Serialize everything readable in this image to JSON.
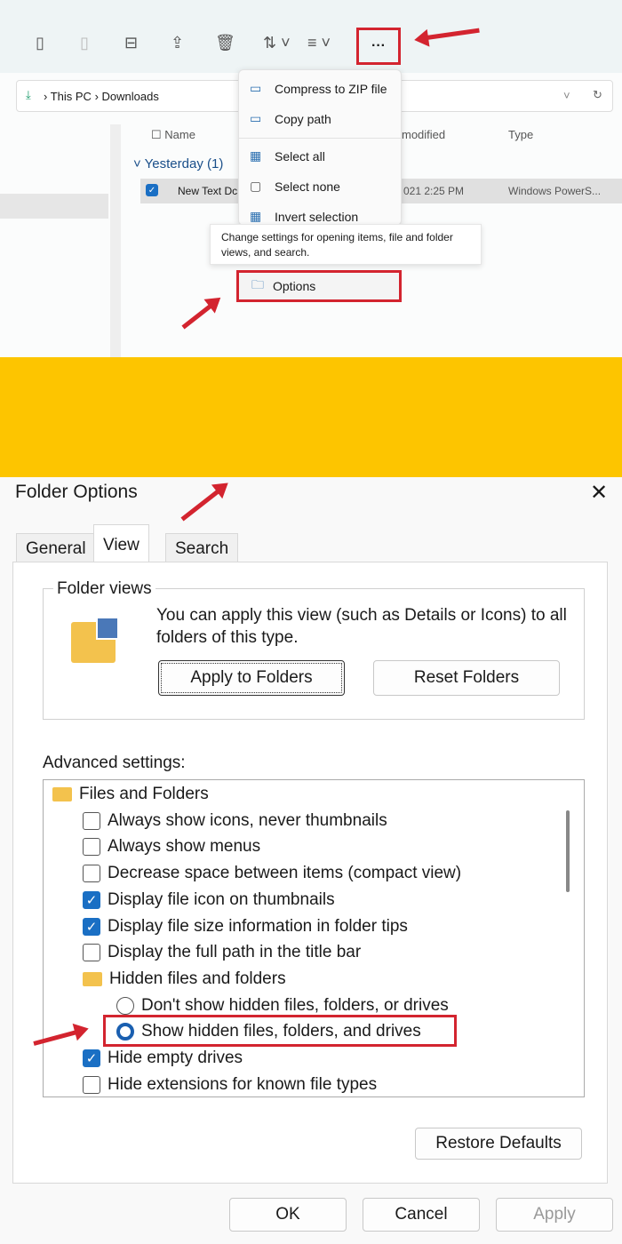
{
  "explorer": {
    "toolbar_icons": [
      "cut-icon",
      "copy-icon",
      "paste-icon",
      "rename-icon",
      "share-icon",
      "delete-icon",
      "sort-icon",
      "view-icon"
    ],
    "more_label": "···",
    "breadcrumb": [
      "This PC",
      "Downloads"
    ],
    "columns": [
      "Name",
      "modified",
      "Type"
    ],
    "group": "Yesterday (1)",
    "file": {
      "name": "New Text Dc",
      "date": "021 2:25 PM",
      "type": "Windows PowerS..."
    },
    "menu": [
      "Compress to ZIP file",
      "Copy path",
      "Select all",
      "Select none",
      "Invert selection"
    ],
    "tooltip": "Change settings for opening items, file and folder views, and search.",
    "options_label": "Options"
  },
  "dialog": {
    "title": "Folder Options",
    "close": "✕",
    "tabs": [
      "General",
      "View",
      "Search"
    ],
    "folder_views": {
      "legend": "Folder views",
      "text": "You can apply this view (such as Details or Icons) to all folders of this type.",
      "apply": "Apply to Folders",
      "reset": "Reset Folders"
    },
    "advanced_label": "Advanced settings:",
    "items": [
      {
        "type": "folder",
        "label": "Files and Folders"
      },
      {
        "type": "check",
        "checked": false,
        "label": "Always show icons, never thumbnails"
      },
      {
        "type": "check",
        "checked": false,
        "label": "Always show menus"
      },
      {
        "type": "check",
        "checked": false,
        "label": "Decrease space between items (compact view)"
      },
      {
        "type": "check",
        "checked": true,
        "label": "Display file icon on thumbnails"
      },
      {
        "type": "check",
        "checked": true,
        "label": "Display file size information in folder tips"
      },
      {
        "type": "check",
        "checked": false,
        "label": "Display the full path in the title bar"
      },
      {
        "type": "folder",
        "label": "Hidden files and folders"
      },
      {
        "type": "radio",
        "checked": false,
        "label": "Don't show hidden files, folders, or drives"
      },
      {
        "type": "radio",
        "checked": true,
        "label": "Show hidden files, folders, and drives"
      },
      {
        "type": "check",
        "checked": true,
        "label": "Hide empty drives"
      },
      {
        "type": "check",
        "checked": false,
        "label": "Hide extensions for known file types"
      }
    ],
    "restore": "Restore Defaults",
    "ok": "OK",
    "cancel": "Cancel",
    "apply": "Apply"
  },
  "colors": {
    "highlight": "#d3242f",
    "band": "#fdc500",
    "accent": "#1a6fc4"
  }
}
